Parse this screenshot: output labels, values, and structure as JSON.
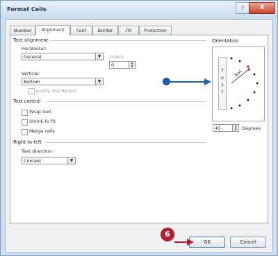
{
  "window": {
    "title": "Format Cells",
    "help_label": "?",
    "close_label": "X"
  },
  "tabs": [
    {
      "label": "Number"
    },
    {
      "label": "Alignment"
    },
    {
      "label": "Font"
    },
    {
      "label": "Border"
    },
    {
      "label": "Fill"
    },
    {
      "label": "Protection"
    }
  ],
  "text_alignment": {
    "group_label": "Text alignment",
    "horizontal_label": "Horizontal:",
    "horizontal_value": "General",
    "indent_label": "Indent:",
    "indent_value": "0",
    "vertical_label": "Vertical:",
    "vertical_value": "Bottom",
    "justify_distributed_label": "Justify distributed"
  },
  "text_control": {
    "group_label": "Text control",
    "wrap_text_label": "Wrap text",
    "shrink_to_fit_label": "Shrink to fit",
    "merge_cells_label": "Merge cells"
  },
  "right_to_left": {
    "group_label": "Right-to-left",
    "text_direction_label": "Text direction:",
    "text_direction_value": "Context"
  },
  "orientation": {
    "group_label": "Orientation",
    "vertical_text": "T e x t",
    "dial_text": "Text",
    "degrees_value": "45",
    "degrees_label": "Degrees"
  },
  "callout": {
    "step_number": "6"
  },
  "buttons": {
    "ok_label": "OK",
    "cancel_label": "Cancel"
  },
  "colors": {
    "callout_blue": "#1f5fa8",
    "callout_red": "#b0202f"
  }
}
